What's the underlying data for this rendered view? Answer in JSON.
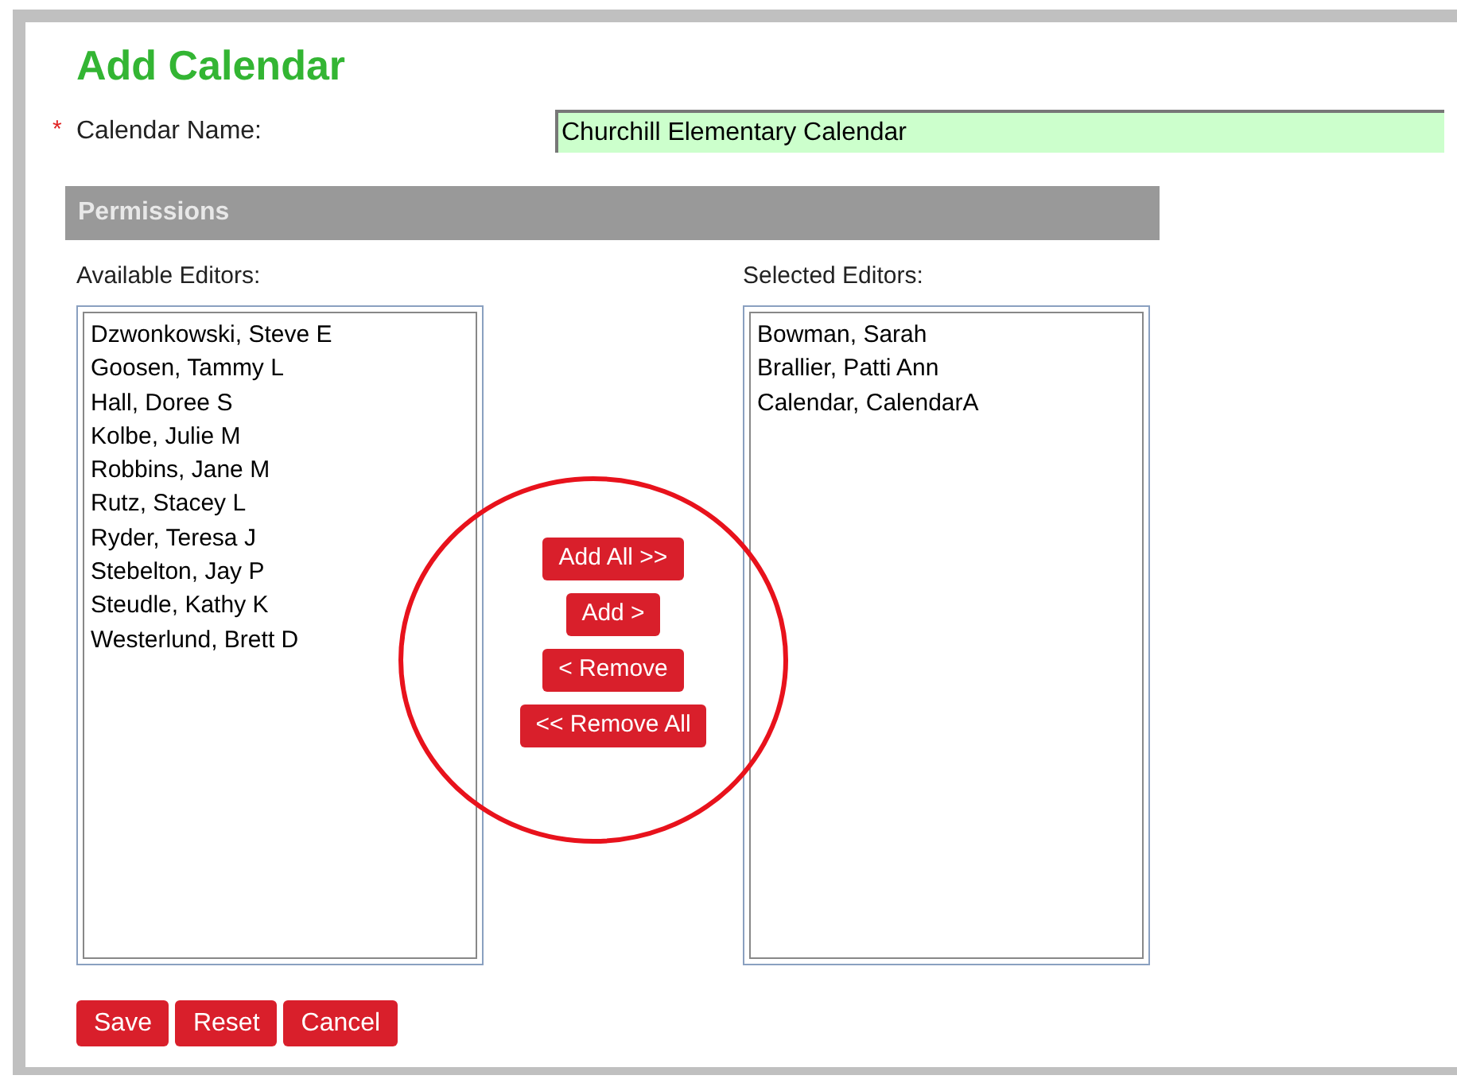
{
  "title": "Add Calendar",
  "calendar_name": {
    "required_mark": "*",
    "label": "Calendar Name:",
    "value": "Churchill Elementary Calendar"
  },
  "permissions": {
    "heading": "Permissions",
    "available": {
      "label": "Available Editors:",
      "items": [
        "Dzwonkowski, Steve E",
        "Goosen, Tammy L",
        "Hall, Doree S",
        "Kolbe, Julie M",
        "Robbins, Jane M",
        "Rutz, Stacey L",
        "Ryder, Teresa J",
        "Stebelton, Jay P",
        "Steudle, Kathy K",
        "Westerlund, Brett D"
      ]
    },
    "transfer_buttons": [
      "Add All >>",
      "Add >",
      "< Remove",
      "<< Remove All"
    ],
    "selected": {
      "label": "Selected Editors:",
      "items": [
        "Bowman, Sarah",
        "Brallier, Patti Ann",
        "Calendar, CalendarA"
      ]
    }
  },
  "buttons": [
    "Save",
    "Reset",
    "Cancel"
  ]
}
